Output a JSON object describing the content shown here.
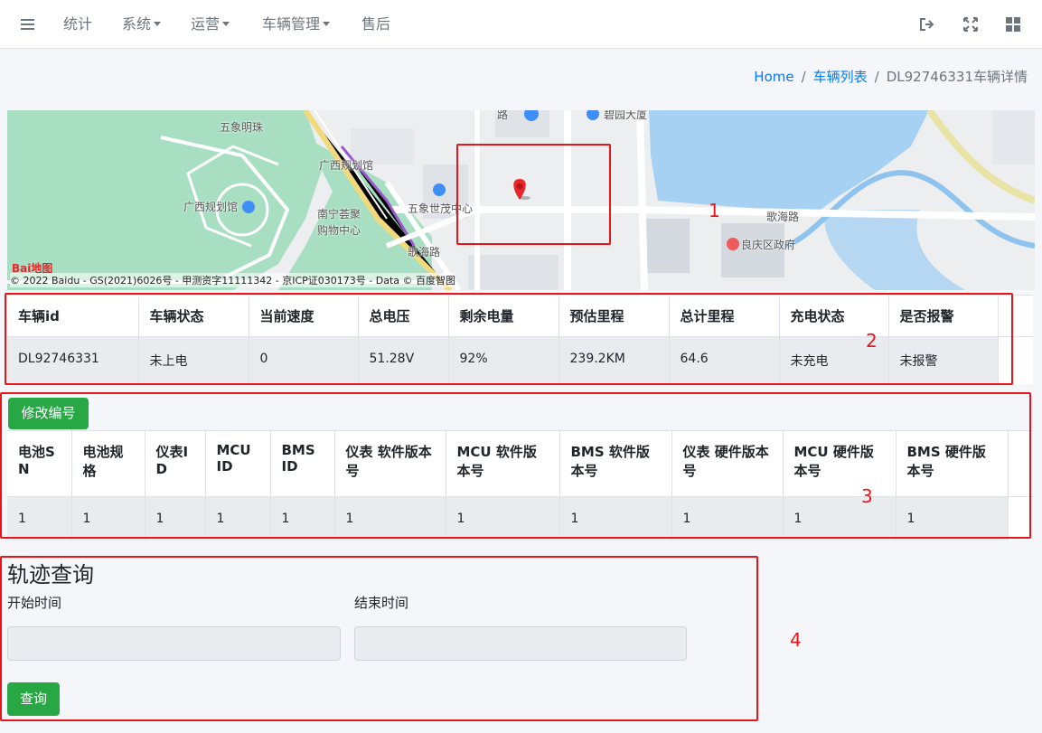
{
  "navbar": {
    "items": [
      {
        "label": "统计",
        "dropdown": false
      },
      {
        "label": "系统",
        "dropdown": true
      },
      {
        "label": "运营",
        "dropdown": true
      },
      {
        "label": "车辆管理",
        "dropdown": true
      },
      {
        "label": "售后",
        "dropdown": false
      }
    ],
    "icons": [
      "menu-icon",
      "logout-icon",
      "fullscreen-icon",
      "grid-icon"
    ]
  },
  "breadcrumb": {
    "home": "Home",
    "list": "车辆列表",
    "current": "DL92746331车辆详情"
  },
  "map": {
    "labels": {
      "wuxiang_mingzhu": "五象明珠",
      "guangxi_guihuaguan_top": "广西规划馆",
      "guangxi_guihuaguan": "广西规划馆",
      "nanning_huiju": "南宁荟聚",
      "gouwu_zhongxin": "购物中心",
      "wuxiang_shimao": "五象世茂中心",
      "gehai_road_1": "歌海路",
      "gehai_road_2": "歌海路",
      "liangqing_gov": "良庆区政府",
      "biyuan": "碧园大厦",
      "road_top": "路"
    },
    "baidu_logo": "Bai地图",
    "copyright": "© 2022 Baidu - GS(2021)6026号 - 甲测资字11111342 - 京ICP证030173号 - Data © 百度智图",
    "marker_color": "#e8262b"
  },
  "status_table": {
    "headers": [
      "车辆id",
      "车辆状态",
      "当前速度",
      "总电压",
      "剩余电量",
      "预估里程",
      "总计里程",
      "充电状态",
      "是否报警"
    ],
    "row": [
      "DL92746331",
      "未上电",
      "0",
      "51.28V",
      "92%",
      "239.2KM",
      "64.6",
      "未充电",
      "未报警"
    ]
  },
  "edit_button": {
    "label": "修改编号"
  },
  "version_table": {
    "headers": [
      "电池SN",
      "电池规格",
      "仪表ID",
      "MCU ID",
      "BMS ID",
      "仪表 软件版本号",
      "MCU 软件版本号",
      "BMS 软件版本号",
      "仪表 硬件版本号",
      "MCU 硬件版本号",
      "BMS 硬件版本号"
    ],
    "row": [
      "1",
      "1",
      "1",
      "1",
      "1",
      "1",
      "1",
      "1",
      "1",
      "1",
      "1"
    ]
  },
  "track_query": {
    "title": "轨迹查询",
    "start_label": "开始时间",
    "end_label": "结束时间",
    "start_value": "",
    "end_value": "",
    "query_button": "查询"
  },
  "annotations": [
    "1",
    "2",
    "3",
    "4"
  ],
  "colors": {
    "accent_blue": "#007bff",
    "success_green": "#28a745",
    "annotation_red": "#e8161b"
  }
}
